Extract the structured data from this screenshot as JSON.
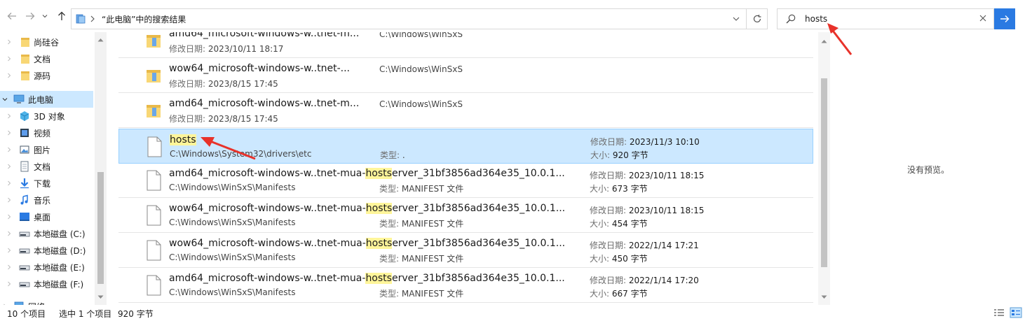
{
  "addressbar": {
    "path": "“此电脑”中的搜索结果"
  },
  "search": {
    "value": "hosts"
  },
  "sidebar": {
    "items": [
      {
        "label": "尚硅谷"
      },
      {
        "label": "文档"
      },
      {
        "label": "源码"
      },
      {
        "label": "此电脑"
      },
      {
        "label": "3D 对象"
      },
      {
        "label": "视频"
      },
      {
        "label": "图片"
      },
      {
        "label": "文档"
      },
      {
        "label": "下载"
      },
      {
        "label": "音乐"
      },
      {
        "label": "桌面"
      },
      {
        "label": "本地磁盘 (C:)"
      },
      {
        "label": "本地磁盘 (D:)"
      },
      {
        "label": "本地磁盘 (E:)"
      },
      {
        "label": "本地磁盘 (F:)"
      },
      {
        "label": "网络"
      }
    ]
  },
  "labels": {
    "modified": "修改日期:",
    "type": "类型:",
    "size": "大小:"
  },
  "results": [
    {
      "name_pre": "amd64_microsoft-windows-w..tnet-m...",
      "name_hl": "",
      "name_post": "",
      "location": "C:\\Windows\\WinSxS",
      "modified": "2023/10/11 18:17",
      "kind": "folder"
    },
    {
      "name_pre": "wow64_microsoft-windows-w..tnet-...",
      "name_hl": "",
      "name_post": "",
      "location": "C:\\Windows\\WinSxS",
      "modified": "2023/8/15 17:45",
      "kind": "folder"
    },
    {
      "name_pre": "amd64_microsoft-windows-w..tnet-m...",
      "name_hl": "",
      "name_post": "",
      "location": "C:\\Windows\\WinSxS",
      "modified": "2023/8/15 17:45",
      "kind": "folder"
    },
    {
      "name_pre": "",
      "name_hl": "hosts",
      "name_post": "",
      "path": "C:\\Windows\\System32\\drivers\\etc",
      "type": ".",
      "modified": "2023/11/3 10:10",
      "size": "920 字节",
      "kind": "file"
    },
    {
      "name_pre": "amd64_microsoft-windows-w..tnet-mua-",
      "name_hl": "hosts",
      "name_post": "erver_31bf3856ad364e35_10.0.1...",
      "path": "C:\\Windows\\WinSxS\\Manifests",
      "type": "MANIFEST 文件",
      "modified": "2023/10/11 18:15",
      "size": "673 字节",
      "kind": "file"
    },
    {
      "name_pre": "wow64_microsoft-windows-w..tnet-mua-",
      "name_hl": "hosts",
      "name_post": "erver_31bf3856ad364e35_10.0.1...",
      "path": "C:\\Windows\\WinSxS\\Manifests",
      "type": "MANIFEST 文件",
      "modified": "2023/10/11 18:15",
      "size": "454 字节",
      "kind": "file"
    },
    {
      "name_pre": "wow64_microsoft-windows-w..tnet-mua-",
      "name_hl": "hosts",
      "name_post": "erver_31bf3856ad364e35_10.0.1...",
      "path": "C:\\Windows\\WinSxS\\Manifests",
      "type": "MANIFEST 文件",
      "modified": "2022/1/14 17:21",
      "size": "450 字节",
      "kind": "file"
    },
    {
      "name_pre": "amd64_microsoft-windows-w..tnet-mua-",
      "name_hl": "hosts",
      "name_post": "erver_31bf3856ad364e35_10.0.1...",
      "path": "C:\\Windows\\WinSxS\\Manifests",
      "type": "MANIFEST 文件",
      "modified": "2022/1/14 17:20",
      "size": "667 字节",
      "kind": "file"
    }
  ],
  "preview": {
    "empty_text": "没有预览。"
  },
  "status": {
    "item_count": "10 个项目",
    "selection": "选中 1 个项目",
    "selection_size": "920 字节"
  },
  "colors": {
    "selection_bg": "#cce8ff",
    "selection_border": "#99d1ff",
    "highlight": "#fff59a",
    "search_button": "#2a7ae2",
    "annotation": "#e8322a"
  }
}
